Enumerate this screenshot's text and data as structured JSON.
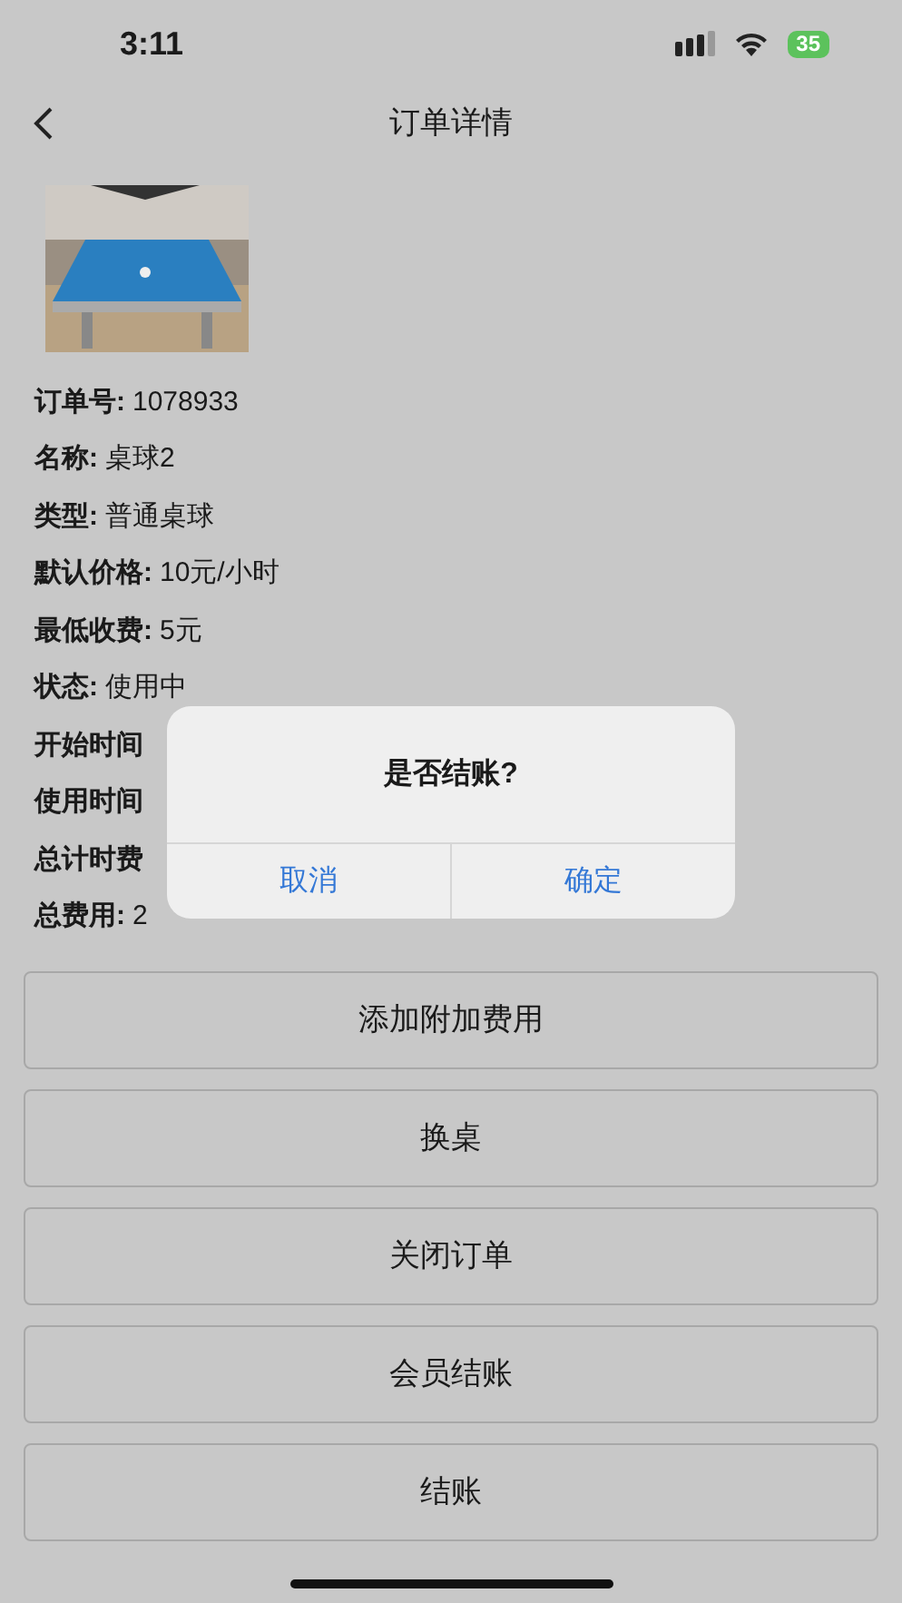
{
  "status_bar": {
    "time": "3:11",
    "battery": "35"
  },
  "nav": {
    "title": "订单详情"
  },
  "fields": [
    {
      "label": "订单号:",
      "value": "1078933"
    },
    {
      "label": "名称:",
      "value": "桌球2"
    },
    {
      "label": "类型:",
      "value": "普通桌球"
    },
    {
      "label": "默认价格:",
      "value": "10元/小时"
    },
    {
      "label": "最低收费:",
      "value": "5元"
    },
    {
      "label": "状态:",
      "value": "使用中"
    },
    {
      "label": "开始时间"
    },
    {
      "label": "使用时间"
    },
    {
      "label": "总计时费"
    },
    {
      "label": "总费用:",
      "value": "2"
    }
  ],
  "buttons": [
    "添加附加费用",
    "换桌",
    "关闭订单",
    "会员结账",
    "结账"
  ],
  "dialog": {
    "title": "是否结账?",
    "buttons": [
      "取消",
      "确定"
    ]
  }
}
